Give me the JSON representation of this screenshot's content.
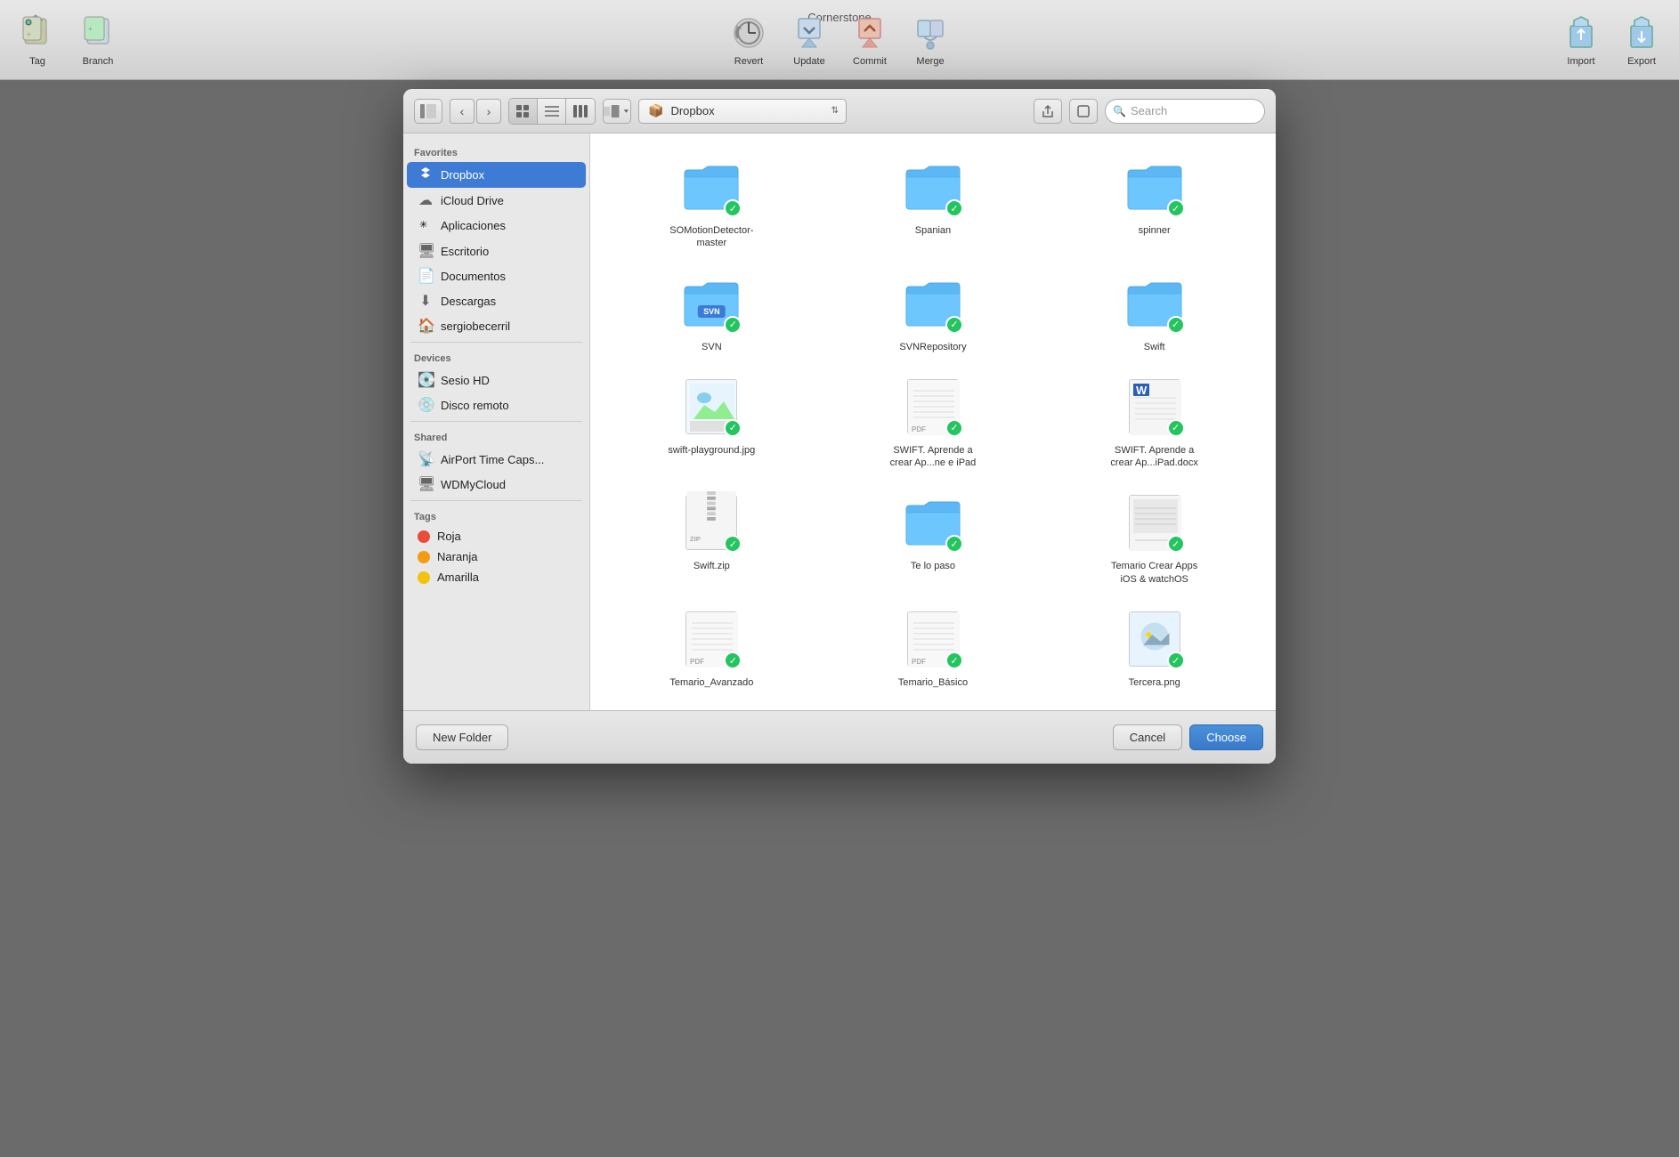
{
  "app": {
    "title": "Cornerstone"
  },
  "toolbar": {
    "items_left": [
      {
        "id": "tag",
        "label": "Tag",
        "icon": "🏷"
      },
      {
        "id": "branch",
        "label": "Branch",
        "icon": "🌿"
      }
    ],
    "items_center": [
      {
        "id": "revert",
        "label": "Revert",
        "icon": "🕐"
      },
      {
        "id": "update",
        "label": "Update",
        "icon": "📦"
      },
      {
        "id": "commit",
        "label": "Commit",
        "icon": "📤"
      },
      {
        "id": "merge",
        "label": "Merge",
        "icon": "🔀"
      }
    ],
    "items_right": [
      {
        "id": "import",
        "label": "Import",
        "icon": "📁"
      },
      {
        "id": "export",
        "label": "Export",
        "icon": "📁"
      }
    ]
  },
  "dialog": {
    "toolbar": {
      "view_sidebar_icon": "⊞",
      "nav_back": "‹",
      "nav_forward": "›",
      "view_icon_grid": "⊞",
      "view_list": "≡",
      "view_column": "⫠",
      "view_cover": "⊞",
      "current_path": "Dropbox",
      "current_path_icon": "📦",
      "share_icon": "⬆",
      "tag_icon": "⌧",
      "search_placeholder": "Search"
    },
    "sidebar": {
      "sections": [
        {
          "label": "Favorites",
          "items": [
            {
              "id": "dropbox",
              "label": "Dropbox",
              "icon": "dropbox",
              "active": true
            },
            {
              "id": "icloud",
              "label": "iCloud Drive",
              "icon": "cloud"
            },
            {
              "id": "aplicaciones",
              "label": "Aplicaciones",
              "icon": "apps"
            },
            {
              "id": "escritorio",
              "label": "Escritorio",
              "icon": "desktop"
            },
            {
              "id": "documentos",
              "label": "Documentos",
              "icon": "doc"
            },
            {
              "id": "descargas",
              "label": "Descargas",
              "icon": "download"
            },
            {
              "id": "sergiobecerril",
              "label": "sergiobecerril",
              "icon": "home"
            }
          ]
        },
        {
          "label": "Devices",
          "items": [
            {
              "id": "sesio_hd",
              "label": "Sesio HD",
              "icon": "hd"
            },
            {
              "id": "disco_remoto",
              "label": "Disco remoto",
              "icon": "disc"
            }
          ]
        },
        {
          "label": "Shared",
          "items": [
            {
              "id": "airport",
              "label": "AirPort Time Caps...",
              "icon": "airport"
            },
            {
              "id": "wdmycloud",
              "label": "WDMyCloud",
              "icon": "nas"
            }
          ]
        },
        {
          "label": "Tags",
          "items": [
            {
              "id": "roja",
              "label": "Roja",
              "icon": "red-dot",
              "color": "#e74c3c"
            },
            {
              "id": "naranja",
              "label": "Naranja",
              "icon": "orange-dot",
              "color": "#f39c12"
            },
            {
              "id": "amarilla",
              "label": "Amarilla",
              "icon": "yellow-dot",
              "color": "#f1c40f"
            }
          ]
        }
      ]
    },
    "files": [
      {
        "id": "somotion",
        "name": "SOMotionDetector-master",
        "type": "folder",
        "checked": true
      },
      {
        "id": "spanian",
        "name": "Spanian",
        "type": "folder",
        "checked": true
      },
      {
        "id": "spinner",
        "name": "spinner",
        "type": "folder",
        "checked": true
      },
      {
        "id": "svn",
        "name": "SVN",
        "type": "folder_svn",
        "checked": true
      },
      {
        "id": "svnrepo",
        "name": "SVNRepository",
        "type": "folder",
        "checked": true
      },
      {
        "id": "swift",
        "name": "Swift",
        "type": "folder",
        "checked": true
      },
      {
        "id": "swift_playground",
        "name": "swift-playground.jpg",
        "type": "image",
        "checked": true
      },
      {
        "id": "swift_aprende_ipad",
        "name": "SWIFT. Aprende a crear Ap...ne e iPad",
        "type": "pdf",
        "checked": true
      },
      {
        "id": "swift_aprende_docx",
        "name": "SWIFT. Aprende a crear Ap...iPad.docx",
        "type": "word",
        "checked": true
      },
      {
        "id": "swift_zip",
        "name": "Swift.zip",
        "type": "zip",
        "checked": true
      },
      {
        "id": "te_lo_paso",
        "name": "Te lo paso",
        "type": "folder",
        "checked": true
      },
      {
        "id": "temario_crear",
        "name": "Temario Crear Apps iOS & watchOS",
        "type": "pages",
        "checked": true
      },
      {
        "id": "temario_avanzado",
        "name": "Temario_Avanzado",
        "type": "pdf",
        "checked": true
      },
      {
        "id": "temario_basico",
        "name": "Temario_Básico",
        "type": "pdf",
        "checked": true
      },
      {
        "id": "tercera",
        "name": "Tercera.png",
        "type": "png",
        "checked": true
      }
    ],
    "footer": {
      "new_folder_label": "New Folder",
      "cancel_label": "Cancel",
      "choose_label": "Choose"
    }
  }
}
